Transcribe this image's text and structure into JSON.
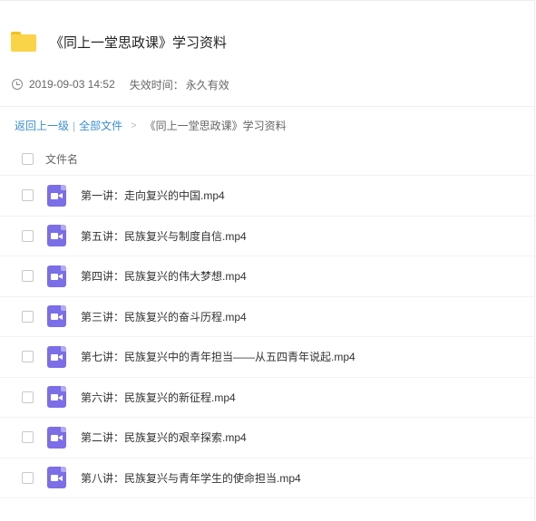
{
  "folder": {
    "icon": "folder-icon",
    "title": "《同上一堂思政课》学习资料"
  },
  "meta": {
    "icon": "clock-icon",
    "date": "2019-09-03 14:52",
    "expire_label": "失效时间：",
    "expire_value": "永久有效"
  },
  "breadcrumb": {
    "back": "返回上一级",
    "separator": "|",
    "all_files": "全部文件",
    "arrow": ">",
    "current": "《同上一堂思政课》学习资料"
  },
  "list": {
    "header": "文件名",
    "files": [
      {
        "name": "第一讲：走向复兴的中国.mp4",
        "icon": "video-file-icon"
      },
      {
        "name": "第五讲：民族复兴与制度自信.mp4",
        "icon": "video-file-icon"
      },
      {
        "name": "第四讲：民族复兴的伟大梦想.mp4",
        "icon": "video-file-icon"
      },
      {
        "name": "第三讲：民族复兴的奋斗历程.mp4",
        "icon": "video-file-icon"
      },
      {
        "name": "第七讲：民族复兴中的青年担当——从五四青年说起.mp4",
        "icon": "video-file-icon"
      },
      {
        "name": "第六讲：民族复兴的新征程.mp4",
        "icon": "video-file-icon"
      },
      {
        "name": "第二讲：民族复兴的艰辛探索.mp4",
        "icon": "video-file-icon"
      },
      {
        "name": "第八讲：民族复兴与青年学生的使命担当.mp4",
        "icon": "video-file-icon"
      }
    ]
  },
  "colors": {
    "link": "#3b8fd6",
    "folder": "#fbd347",
    "video_icon": "#7b6ee6"
  }
}
